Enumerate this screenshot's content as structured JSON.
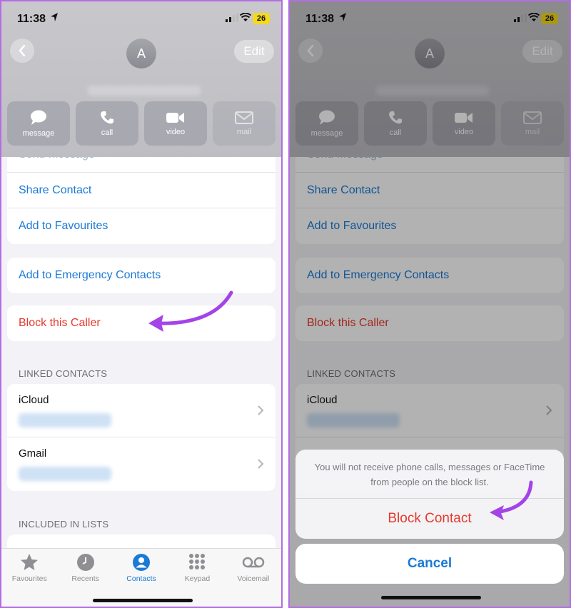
{
  "colors": {
    "accent": "#1b7ad6",
    "destructive": "#e7392c",
    "arrow": "#a343e8",
    "frame": "#b36de3"
  },
  "status": {
    "time": "11:38",
    "battery": "26"
  },
  "header": {
    "avatar_initial": "A",
    "edit_label": "Edit",
    "back_icon": "chevron-left-icon"
  },
  "actions": [
    {
      "label": "message",
      "icon": "message-icon"
    },
    {
      "label": "call",
      "icon": "phone-icon"
    },
    {
      "label": "video",
      "icon": "video-icon"
    },
    {
      "label": "mail",
      "icon": "mail-icon"
    }
  ],
  "list": {
    "send_message": "Send Message",
    "share_contact": "Share Contact",
    "add_favourites": "Add to Favourites",
    "add_emergency": "Add to Emergency Contacts",
    "block_caller": "Block this Caller"
  },
  "linked": {
    "header": "LINKED CONTACTS",
    "items": [
      {
        "source": "iCloud"
      },
      {
        "source": "Gmail"
      }
    ]
  },
  "lists_header": "INCLUDED IN LISTS",
  "tabs": [
    {
      "label": "Favourites",
      "icon": "star-icon"
    },
    {
      "label": "Recents",
      "icon": "clock-icon"
    },
    {
      "label": "Contacts",
      "icon": "person-icon",
      "active": true
    },
    {
      "label": "Keypad",
      "icon": "keypad-icon"
    },
    {
      "label": "Voicemail",
      "icon": "voicemail-icon"
    }
  ],
  "sheet": {
    "message": "You will not receive phone calls, messages or FaceTime from people on the block list.",
    "block_label": "Block Contact",
    "cancel_label": "Cancel"
  }
}
